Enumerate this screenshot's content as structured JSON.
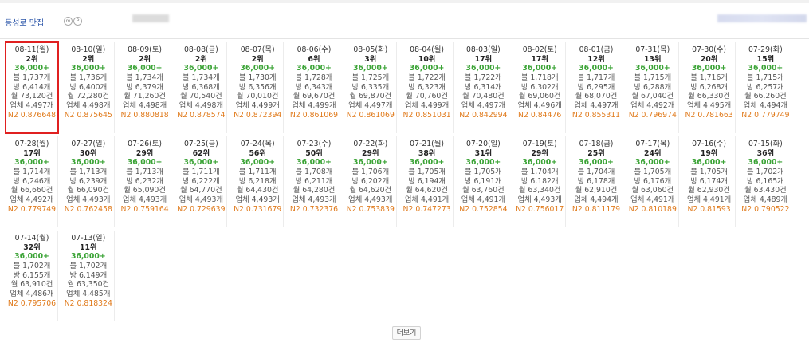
{
  "header": {
    "keyword": "동성로 맛집",
    "icon_a": "m",
    "icon_b": "P"
  },
  "labels": {
    "blog": "블",
    "cafe": "방",
    "monthly": "월",
    "total": "업체"
  },
  "more_label": "더보기",
  "colors": {
    "link": "#2a54a8",
    "volume": "#3aa335",
    "n2": "#e07a1b",
    "highlight": "#e02020"
  },
  "entries": [
    {
      "date": "08-11(월)",
      "rank": "2위",
      "volume": "36,000+",
      "blog": "블 1,737개",
      "cafe": "방 6,414개",
      "monthly": "월 73,120건",
      "total": "업체 4,497개",
      "n2": "N2 0.876648"
    },
    {
      "date": "08-10(일)",
      "rank": "2위",
      "volume": "36,000+",
      "blog": "블 1,736개",
      "cafe": "방 6,400개",
      "monthly": "월 72,280건",
      "total": "업체 4,498개",
      "n2": "N2 0.875645"
    },
    {
      "date": "08-09(토)",
      "rank": "2위",
      "volume": "36,000+",
      "blog": "블 1,734개",
      "cafe": "방 6,379개",
      "monthly": "월 71,260건",
      "total": "업체 4,498개",
      "n2": "N2 0.880818"
    },
    {
      "date": "08-08(금)",
      "rank": "2위",
      "volume": "36,000+",
      "blog": "블 1,734개",
      "cafe": "방 6,368개",
      "monthly": "월 70,540건",
      "total": "업체 4,498개",
      "n2": "N2 0.878574"
    },
    {
      "date": "08-07(목)",
      "rank": "2위",
      "volume": "36,000+",
      "blog": "블 1,730개",
      "cafe": "방 6,356개",
      "monthly": "월 70,010건",
      "total": "업체 4,499개",
      "n2": "N2 0.872394"
    },
    {
      "date": "08-06(수)",
      "rank": "6위",
      "volume": "36,000+",
      "blog": "블 1,728개",
      "cafe": "방 6,343개",
      "monthly": "월 69,670건",
      "total": "업체 4,499개",
      "n2": "N2 0.861069"
    },
    {
      "date": "08-05(화)",
      "rank": "3위",
      "volume": "36,000+",
      "blog": "블 1,725개",
      "cafe": "방 6,335개",
      "monthly": "월 69,870건",
      "total": "업체 4,497개",
      "n2": "N2 0.861069"
    },
    {
      "date": "08-04(월)",
      "rank": "10위",
      "volume": "36,000+",
      "blog": "블 1,722개",
      "cafe": "방 6,323개",
      "monthly": "월 70,760건",
      "total": "업체 4,499개",
      "n2": "N2 0.851031"
    },
    {
      "date": "08-03(일)",
      "rank": "17위",
      "volume": "36,000+",
      "blog": "블 1,722개",
      "cafe": "방 6,314개",
      "monthly": "월 70,480건",
      "total": "업체 4,497개",
      "n2": "N2 0.842994"
    },
    {
      "date": "08-02(토)",
      "rank": "17위",
      "volume": "36,000+",
      "blog": "블 1,718개",
      "cafe": "방 6,302개",
      "monthly": "월 69,060건",
      "total": "업체 4,496개",
      "n2": "N2 0.84476"
    },
    {
      "date": "08-01(금)",
      "rank": "12위",
      "volume": "36,000+",
      "blog": "블 1,717개",
      "cafe": "방 6,295개",
      "monthly": "월 68,070건",
      "total": "업체 4,497개",
      "n2": "N2 0.855311"
    },
    {
      "date": "07-31(목)",
      "rank": "13위",
      "volume": "36,000+",
      "blog": "블 1,715개",
      "cafe": "방 6,288개",
      "monthly": "월 67,040건",
      "total": "업체 4,492개",
      "n2": "N2 0.796974"
    },
    {
      "date": "07-30(수)",
      "rank": "20위",
      "volume": "36,000+",
      "blog": "블 1,716개",
      "cafe": "방 6,268개",
      "monthly": "월 66,330건",
      "total": "업체 4,495개",
      "n2": "N2 0.781663"
    },
    {
      "date": "07-29(화)",
      "rank": "15위",
      "volume": "36,000+",
      "blog": "블 1,715개",
      "cafe": "방 6,257개",
      "monthly": "월 66,260건",
      "total": "업체 4,494개",
      "n2": "N2 0.779749"
    },
    {
      "date": "07-28(월)",
      "rank": "17위",
      "volume": "36,000+",
      "blog": "블 1,714개",
      "cafe": "방 6,246개",
      "monthly": "월 66,660건",
      "total": "업체 4,492개",
      "n2": "N2 0.779749"
    },
    {
      "date": "07-27(일)",
      "rank": "30위",
      "volume": "36,000+",
      "blog": "블 1,713개",
      "cafe": "방 6,239개",
      "monthly": "월 66,090건",
      "total": "업체 4,493개",
      "n2": "N2 0.762458"
    },
    {
      "date": "07-26(토)",
      "rank": "29위",
      "volume": "36,000+",
      "blog": "블 1,713개",
      "cafe": "방 6,232개",
      "monthly": "월 65,090건",
      "total": "업체 4,493개",
      "n2": "N2 0.759164"
    },
    {
      "date": "07-25(금)",
      "rank": "62위",
      "volume": "36,000+",
      "blog": "블 1,711개",
      "cafe": "방 6,222개",
      "monthly": "월 64,770건",
      "total": "업체 4,493개",
      "n2": "N2 0.729639"
    },
    {
      "date": "07-24(목)",
      "rank": "56위",
      "volume": "36,000+",
      "blog": "블 1,711개",
      "cafe": "방 6,218개",
      "monthly": "월 64,430건",
      "total": "업체 4,493개",
      "n2": "N2 0.731679"
    },
    {
      "date": "07-23(수)",
      "rank": "50위",
      "volume": "36,000+",
      "blog": "블 1,708개",
      "cafe": "방 6,211개",
      "monthly": "월 64,280건",
      "total": "업체 4,493개",
      "n2": "N2 0.732376"
    },
    {
      "date": "07-22(화)",
      "rank": "29위",
      "volume": "36,000+",
      "blog": "블 1,706개",
      "cafe": "방 6,202개",
      "monthly": "월 64,620건",
      "total": "업체 4,493개",
      "n2": "N2 0.753839"
    },
    {
      "date": "07-21(월)",
      "rank": "38위",
      "volume": "36,000+",
      "blog": "블 1,705개",
      "cafe": "방 6,194개",
      "monthly": "월 64,620건",
      "total": "업체 4,491개",
      "n2": "N2 0.747273"
    },
    {
      "date": "07-20(일)",
      "rank": "31위",
      "volume": "36,000+",
      "blog": "블 1,705개",
      "cafe": "방 6,191개",
      "monthly": "월 63,760건",
      "total": "업체 4,491개",
      "n2": "N2 0.752854"
    },
    {
      "date": "07-19(토)",
      "rank": "29위",
      "volume": "36,000+",
      "blog": "블 1,704개",
      "cafe": "방 6,182개",
      "monthly": "월 63,340건",
      "total": "업체 4,493개",
      "n2": "N2 0.756017"
    },
    {
      "date": "07-18(금)",
      "rank": "25위",
      "volume": "36,000+",
      "blog": "블 1,704개",
      "cafe": "방 6,178개",
      "monthly": "월 62,910건",
      "total": "업체 4,494개",
      "n2": "N2 0.811179"
    },
    {
      "date": "07-17(목)",
      "rank": "24위",
      "volume": "36,000+",
      "blog": "블 1,705개",
      "cafe": "방 6,176개",
      "monthly": "월 63,060건",
      "total": "업체 4,491개",
      "n2": "N2 0.810189"
    },
    {
      "date": "07-16(수)",
      "rank": "19위",
      "volume": "36,000+",
      "blog": "블 1,705개",
      "cafe": "방 6,174개",
      "monthly": "월 62,930건",
      "total": "업체 4,491개",
      "n2": "N2 0.81593"
    },
    {
      "date": "07-15(화)",
      "rank": "36위",
      "volume": "36,000+",
      "blog": "블 1,702개",
      "cafe": "방 6,165개",
      "monthly": "월 63,430건",
      "total": "업체 4,489개",
      "n2": "N2 0.790522"
    },
    {
      "date": "07-14(월)",
      "rank": "32위",
      "volume": "36,000+",
      "blog": "블 1,702개",
      "cafe": "방 6,155개",
      "monthly": "월 63,910건",
      "total": "업체 4,486개",
      "n2": "N2 0.795706"
    },
    {
      "date": "07-13(일)",
      "rank": "11위",
      "volume": "36,000+",
      "blog": "블 1,702개",
      "cafe": "방 6,149개",
      "monthly": "월 63,350건",
      "total": "업체 4,485개",
      "n2": "N2 0.818324"
    }
  ]
}
